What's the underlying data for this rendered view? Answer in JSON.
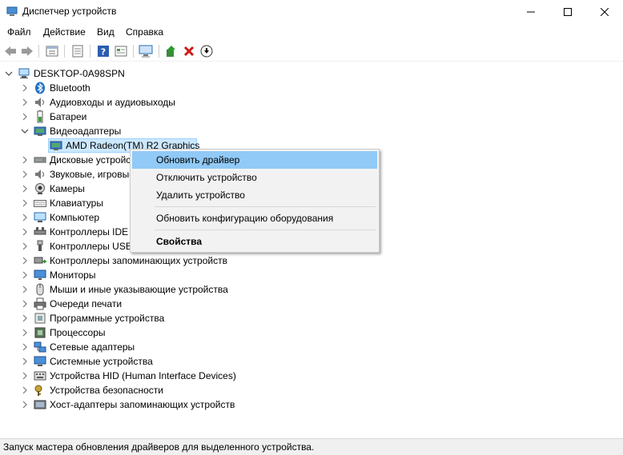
{
  "window": {
    "title": "Диспетчер устройств"
  },
  "menu": [
    "Файл",
    "Действие",
    "Вид",
    "Справка"
  ],
  "toolbar_icons": [
    "back-icon",
    "forward-icon",
    "properties-icon",
    "show-hide-icon",
    "help-icon",
    "resources-icon",
    "monitor-scan-icon",
    "update-driver-icon",
    "uninstall-icon",
    "download-icon"
  ],
  "tree": {
    "root": "DESKTOP-0A98SPN",
    "items": [
      "Bluetooth",
      "Аудиовходы и аудиовыходы",
      "Батареи",
      "Видеоадаптеры",
      "AMD Radeon(TM) R2 Graphics",
      "Дисковые устройства",
      "Звуковые, игровые и видеоустройства",
      "Камеры",
      "Клавиатуры",
      "Компьютер",
      "Контроллеры IDE ATA/ATAPI",
      "Контроллеры USB",
      "Контроллеры запоминающих устройств",
      "Мониторы",
      "Мыши и иные указывающие устройства",
      "Очереди печати",
      "Программные устройства",
      "Процессоры",
      "Сетевые адаптеры",
      "Системные устройства",
      "Устройства HID (Human Interface Devices)",
      "Устройства безопасности",
      "Хост-адаптеры запоминающих устройств"
    ]
  },
  "context_menu": {
    "items": [
      "Обновить драйвер",
      "Отключить устройство",
      "Удалить устройство",
      "Обновить конфигурацию оборудования",
      "Свойства"
    ]
  },
  "status": "Запуск мастера обновления драйверов для выделенного устройства."
}
